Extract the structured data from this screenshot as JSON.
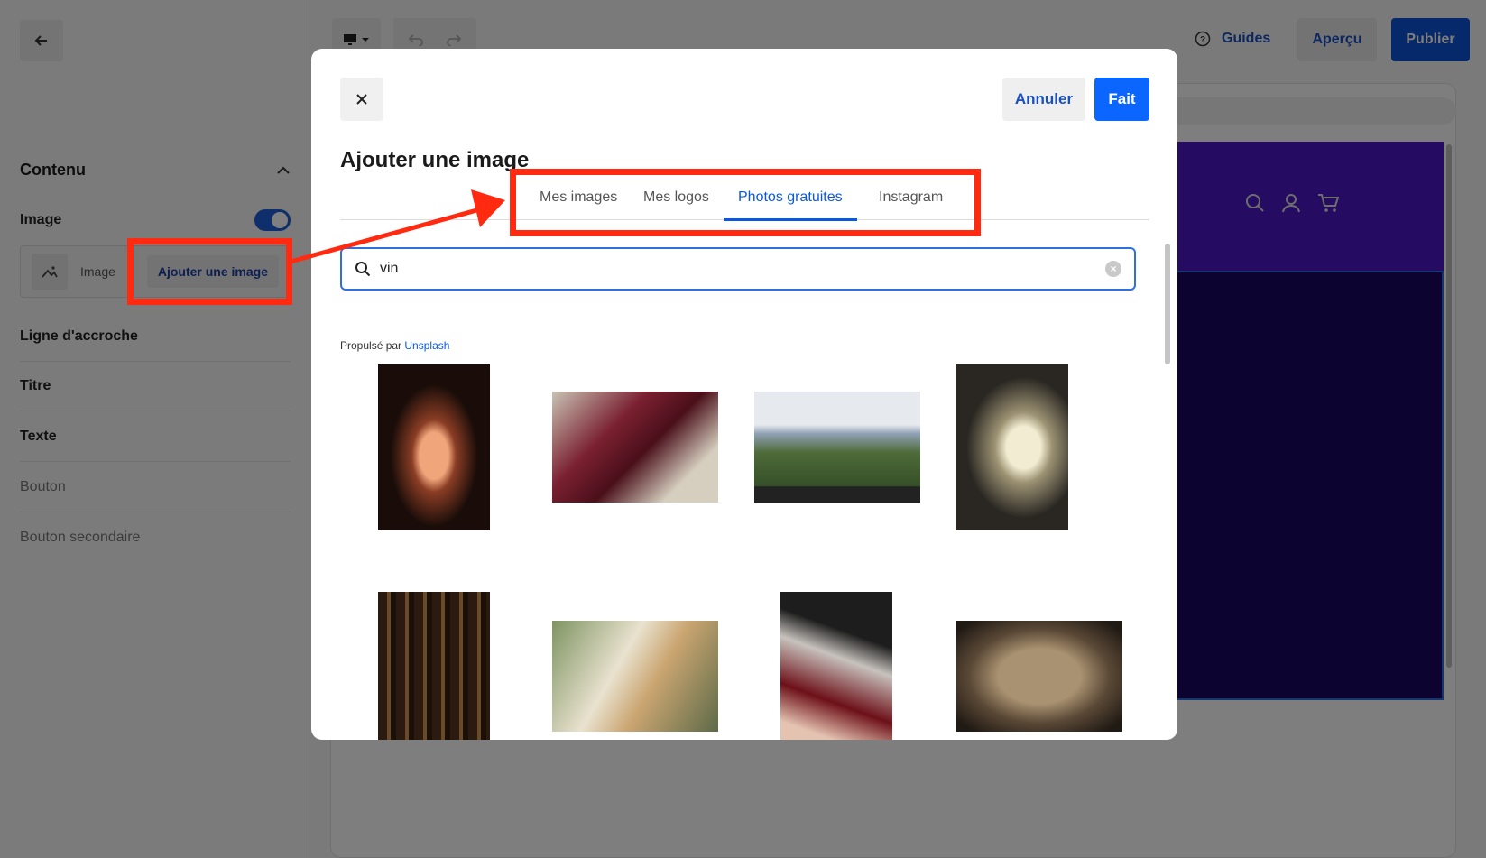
{
  "left_panel": {
    "section_title": "Contenu",
    "image_label": "Image",
    "image_toggle": "on",
    "image_box_label": "Image",
    "add_image_button": "Ajouter une image",
    "items": [
      "Ligne d'accroche",
      "Titre",
      "Texte",
      "Bouton",
      "Bouton secondaire"
    ]
  },
  "top_bar": {
    "guides": "Guides",
    "apercu": "Aperçu",
    "publier": "Publier"
  },
  "modal": {
    "title": "Ajouter une image",
    "cancel": "Annuler",
    "done": "Fait",
    "tabs": [
      {
        "label": "Mes images",
        "active": false
      },
      {
        "label": "Mes logos",
        "active": false
      },
      {
        "label": "Photos gratuites",
        "active": true
      },
      {
        "label": "Instagram",
        "active": false
      }
    ],
    "search": {
      "value": "vin"
    },
    "powered_prefix": "Propulsé par",
    "powered_link": "Unsplash"
  },
  "colors": {
    "primary": "#0a66ff",
    "highlight": "#ff2a10",
    "site_header": "#4b16c4",
    "site_hero": "#180660"
  },
  "icons": [
    "back-arrow-icon",
    "chevron-up-icon",
    "image-placeholder-icon",
    "desktop-icon",
    "undo-icon",
    "redo-icon",
    "help-icon",
    "search-icon",
    "user-icon",
    "cart-icon",
    "close-icon",
    "clear-icon"
  ]
}
